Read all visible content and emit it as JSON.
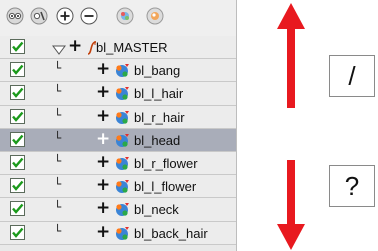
{
  "toolbar": {
    "icons": [
      "show-all-icon",
      "hide-all-icon",
      "expand-icon",
      "collapse-icon",
      "add-layer-icon",
      "add-folder-icon"
    ]
  },
  "layers": [
    {
      "name": "bl_MASTER",
      "checked": true,
      "selected": false,
      "level": 0
    },
    {
      "name": "bl_bang",
      "checked": true,
      "selected": false,
      "level": 1
    },
    {
      "name": "bl_l_hair",
      "checked": true,
      "selected": false,
      "level": 1
    },
    {
      "name": "bl_r_hair",
      "checked": true,
      "selected": false,
      "level": 1
    },
    {
      "name": "bl_head",
      "checked": true,
      "selected": true,
      "level": 1
    },
    {
      "name": "bl_r_flower",
      "checked": true,
      "selected": false,
      "level": 1
    },
    {
      "name": "bl_l_flower",
      "checked": true,
      "selected": false,
      "level": 1
    },
    {
      "name": "bl_neck",
      "checked": true,
      "selected": false,
      "level": 1
    },
    {
      "name": "bl_back_hair",
      "checked": true,
      "selected": false,
      "level": 1
    }
  ],
  "keys": {
    "up": "/",
    "down": "?"
  },
  "colors": {
    "arrow": "#e8191f",
    "check": "#1b9a1b",
    "selected_row": "#a9adb9"
  }
}
